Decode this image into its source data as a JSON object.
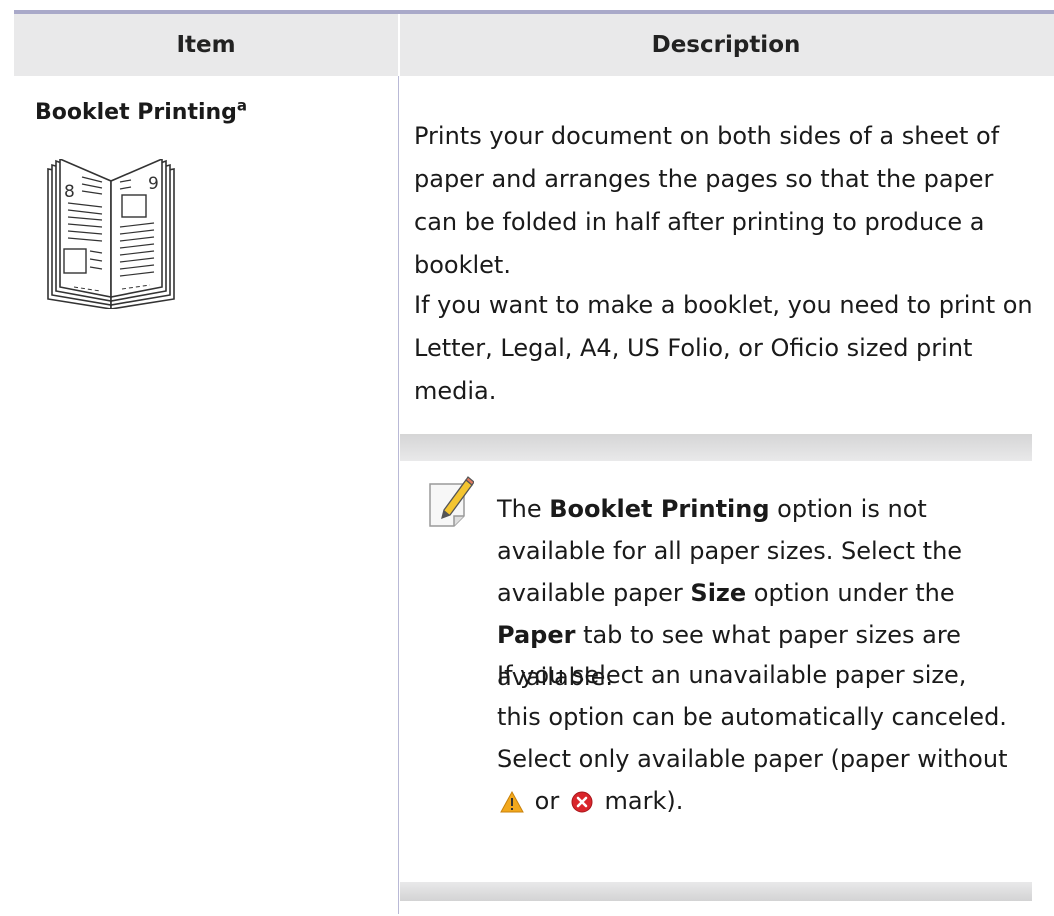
{
  "table": {
    "header_item": "Item",
    "header_description": "Description"
  },
  "row": {
    "item_name": "Booklet Printing",
    "item_superscript": "a",
    "icon_page_left": "8",
    "icon_page_right": "9",
    "desc_p1": "Prints your document on both sides of a sheet of paper and arranges the pages so that the paper can be folded in half after printing to produce a booklet.",
    "desc_p2": "If you want to make a booklet, you need to print on Letter, Legal, A4, US Folio, or Oficio sized print media."
  },
  "note": {
    "p1_a": "The ",
    "p1_b": "Booklet Printing",
    "p1_c": " option is not available for all paper sizes. Select the available paper ",
    "p1_d": "Size",
    "p1_e": " option under the ",
    "p1_f": "Paper",
    "p1_g": " tab to see what paper sizes are available.",
    "p2_a": "If you select an unavailable paper size, this option can be automatically canceled. Select only available paper (paper without",
    "p2_b": "or",
    "p2_c": "mark).",
    "warning_icon": "warning-triangle-icon",
    "error_icon": "error-x-icon"
  },
  "colors": {
    "header_bg": "#e9e9ea",
    "rule": "#a9a9c9",
    "warning": "#f2a81d",
    "error": "#d9262c"
  }
}
